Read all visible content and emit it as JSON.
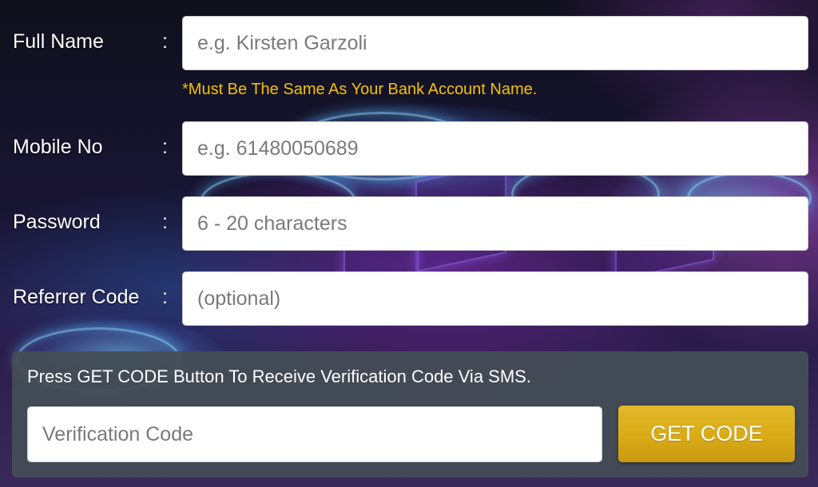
{
  "form": {
    "full_name": {
      "label": "Full Name",
      "colon": ":",
      "placeholder": "e.g. Kirsten Garzoli",
      "value": "",
      "note": "*Must Be The Same As Your Bank Account Name."
    },
    "mobile": {
      "label": "Mobile No",
      "colon": ":",
      "placeholder": "e.g. 61480050689",
      "value": ""
    },
    "password": {
      "label": "Password",
      "colon": ":",
      "placeholder": "6 - 20 characters",
      "value": ""
    },
    "referrer": {
      "label": "Referrer Code",
      "colon": ":",
      "placeholder": "(optional)",
      "value": ""
    }
  },
  "verification": {
    "instruction": "Press GET CODE Button To Receive Verification Code Via SMS.",
    "placeholder": "Verification Code",
    "value": "",
    "button_label": "GET CODE"
  },
  "colors": {
    "note": "#f2c200",
    "button": "#d9aa17",
    "panel": "#444e56",
    "label": "#ffffff"
  }
}
